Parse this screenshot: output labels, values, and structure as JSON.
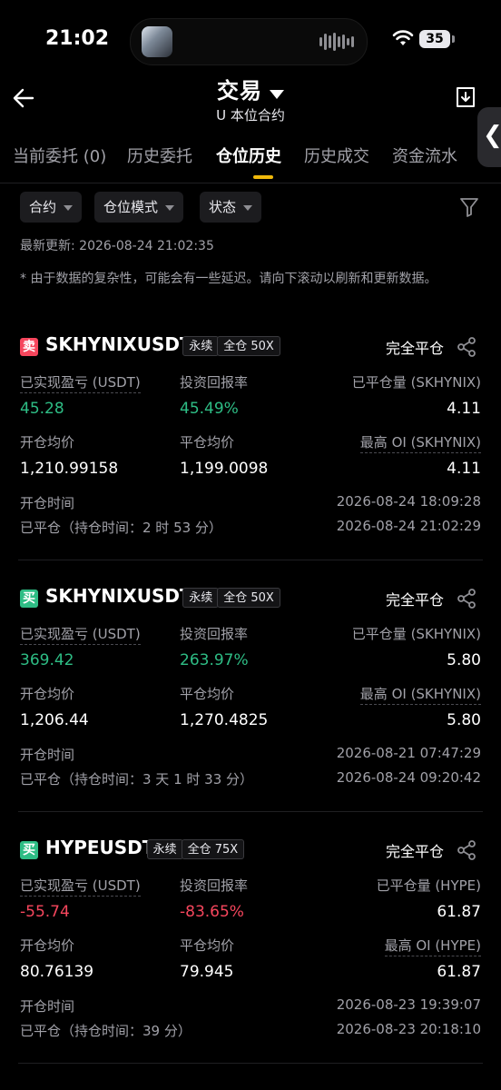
{
  "status_bar": {
    "time": "21:02",
    "battery": "35"
  },
  "header": {
    "title": "交易",
    "subtitle": "U 本位合约"
  },
  "tabs": [
    {
      "label": "当前委托 (0)",
      "active": false
    },
    {
      "label": "历史委托",
      "active": false
    },
    {
      "label": "仓位历史",
      "active": true
    },
    {
      "label": "历史成交",
      "active": false
    },
    {
      "label": "资金流水",
      "active": false
    }
  ],
  "filters": [
    {
      "label": "合约"
    },
    {
      "label": "仓位模式"
    },
    {
      "label": "状态"
    }
  ],
  "last_updated": "最新更新: 2026-08-24 21:02:35",
  "note": "* 由于数据的复杂性，可能会有一些延迟。请向下滚动以刷新和更新数据。",
  "labels": {
    "realized_pnl": "已实现盈亏 (USDT)",
    "roi": "投资回报率",
    "avg_open": "开仓均价",
    "avg_close": "平仓均价",
    "open_time": "开仓时间",
    "close_all": "完全平仓"
  },
  "colors": {
    "buy": "#2ebd85",
    "sell": "#f6465d",
    "accent": "#f0b90b"
  },
  "positions": [
    {
      "side": "卖",
      "side_type": "sell",
      "symbol": "SKHYNIXUSDT",
      "tag_type": "永续",
      "tag_margin": "全仓 50X",
      "realized_pnl": "45.28",
      "roi": "45.49%",
      "pnl_sign": "pos",
      "closed_qty_label": "已平仓量 (SKHYNIX)",
      "closed_qty": "4.11",
      "avg_open": "1,210.99158",
      "avg_close": "1,199.0098",
      "max_oi_label": "最高 OI (SKHYNIX)",
      "max_oi": "4.11",
      "open_time": "2026-08-24 18:09:28",
      "closed_label": "已平仓（持仓时间：2 时 53 分）",
      "close_time": "2026-08-24 21:02:29"
    },
    {
      "side": "买",
      "side_type": "buy",
      "symbol": "SKHYNIXUSDT",
      "tag_type": "永续",
      "tag_margin": "全仓 50X",
      "realized_pnl": "369.42",
      "roi": "263.97%",
      "pnl_sign": "pos",
      "closed_qty_label": "已平仓量 (SKHYNIX)",
      "closed_qty": "5.80",
      "avg_open": "1,206.44",
      "avg_close": "1,270.4825",
      "max_oi_label": "最高 OI (SKHYNIX)",
      "max_oi": "5.80",
      "open_time": "2026-08-21 07:47:29",
      "closed_label": "已平仓（持仓时间：3 天 1 时 33 分）",
      "close_time": "2026-08-24 09:20:42"
    },
    {
      "side": "买",
      "side_type": "buy",
      "symbol": "HYPEUSDT",
      "tag_type": "永续",
      "tag_margin": "全仓 75X",
      "realized_pnl": "-55.74",
      "roi": "-83.65%",
      "pnl_sign": "neg",
      "closed_qty_label": "已平仓量 (HYPE)",
      "closed_qty": "61.87",
      "avg_open": "80.76139",
      "avg_close": "79.945",
      "max_oi_label": "最高 OI (HYPE)",
      "max_oi": "61.87",
      "open_time": "2026-08-23 19:39:07",
      "closed_label": "已平仓（持仓时间：39 分）",
      "close_time": "2026-08-23 20:18:10"
    }
  ]
}
